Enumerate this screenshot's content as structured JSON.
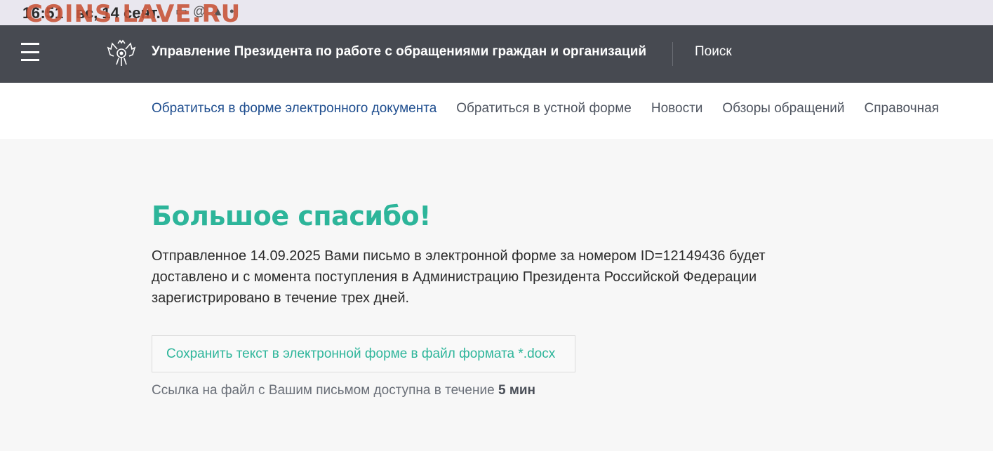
{
  "status_bar": {
    "time": "16:51",
    "date": "вс, 14 сент.",
    "watermark": "COINS.LAVE.RU"
  },
  "header": {
    "org_title": "Управление Президента по работе с обращениями граждан и организаций",
    "search_label": "Поиск",
    "menu_icon": "hamburger-icon",
    "emblem_icon": "double-headed-eagle-emblem"
  },
  "nav": {
    "items": [
      {
        "label": "Обратиться в форме электронного документа",
        "active": true
      },
      {
        "label": "Обратиться в устной форме",
        "active": false
      },
      {
        "label": "Новости",
        "active": false
      },
      {
        "label": "Обзоры обращений",
        "active": false
      },
      {
        "label": "Справочная",
        "active": false
      }
    ]
  },
  "main": {
    "title": "Большое спасибо!",
    "message": "Отправленное 14.09.2025 Вами письмо в электронной форме за номером ID=12149436 будет доставлено и с момента поступления в Администрацию Президента Российской Федерации зарегистрировано в течение трех дней.",
    "save_button_label": "Сохранить текст в электронной форме в файл формата *.docx",
    "link_note_prefix": "Ссылка на файл с Вашим письмом доступна в течение",
    "link_note_duration": "5 мин"
  },
  "colors": {
    "header_bg": "#474a51",
    "accent_green": "#2db59a",
    "active_nav": "#1f4e8f"
  }
}
